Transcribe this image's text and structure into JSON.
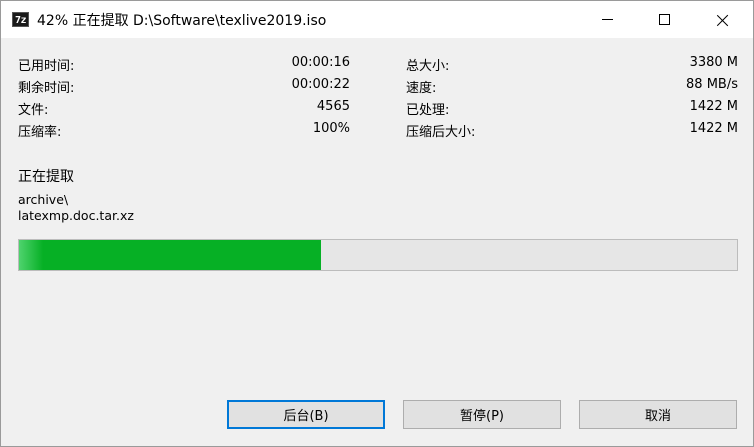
{
  "window": {
    "title": "42% 正在提取 D:\\Software\\texlive2019.iso",
    "app_icon_text": "7z"
  },
  "stats_left": [
    {
      "label": "已用时间:",
      "value": "00:00:16"
    },
    {
      "label": "剩余时间:",
      "value": "00:00:22"
    },
    {
      "label": "文件:",
      "value": "4565"
    },
    {
      "label": "压缩率:",
      "value": "100%"
    }
  ],
  "stats_right": [
    {
      "label": "总大小:",
      "value": "3380 M"
    },
    {
      "label": "速度:",
      "value": "88 MB/s"
    },
    {
      "label": "已处理:",
      "value": "1422 M"
    },
    {
      "label": "压缩后大小:",
      "value": "1422 M"
    }
  ],
  "operation": {
    "title": "正在提取",
    "path_line1": "archive\\",
    "path_line2": "latexmp.doc.tar.xz"
  },
  "progress": {
    "percent": 42,
    "fill_color": "#06b025"
  },
  "buttons": {
    "background": "后台(B)",
    "pause": "暂停(P)",
    "cancel": "取消"
  },
  "colors": {
    "accent": "#0078d7"
  }
}
